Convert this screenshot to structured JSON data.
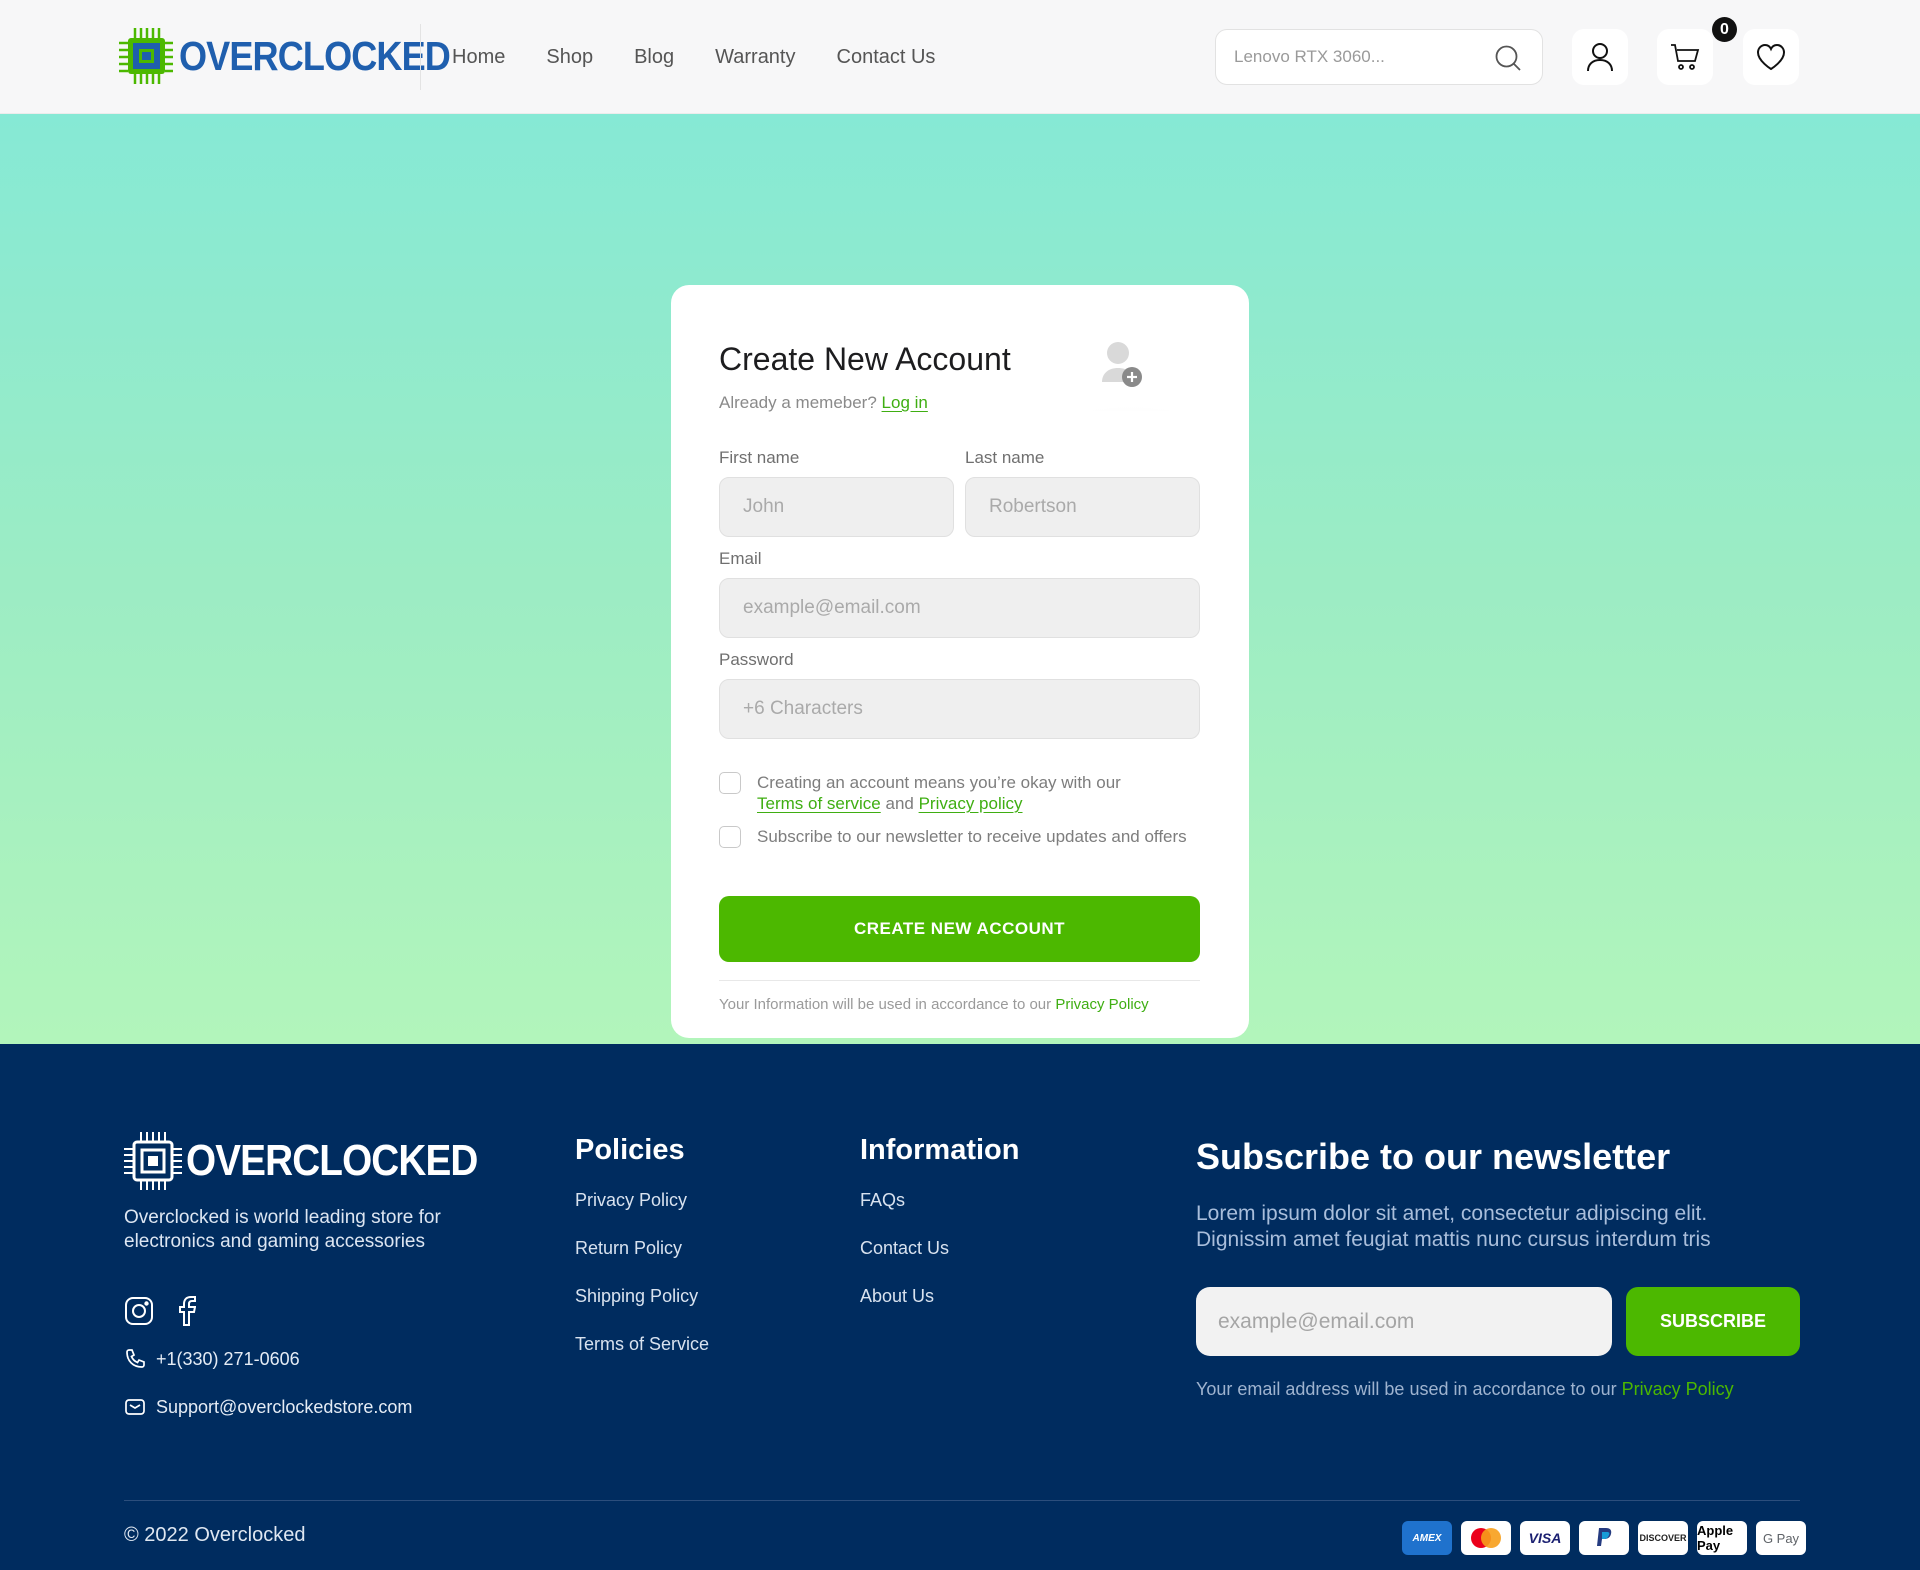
{
  "header": {
    "brand": "OVERCLOCKED",
    "nav": [
      "Home",
      "Shop",
      "Blog",
      "Warranty",
      "Contact Us"
    ],
    "search_placeholder": "Lenovo RTX 3060...",
    "cart_count": "0"
  },
  "signup": {
    "title": "Create New Account",
    "already_text": "Already a memeber?",
    "login_link": "Log in",
    "first_name_label": "First name",
    "first_name_placeholder": "John",
    "last_name_label": "Last name",
    "last_name_placeholder": "Robertson",
    "email_label": "Email",
    "email_placeholder": "example@email.com",
    "password_label": "Password",
    "password_placeholder": "+6 Characters",
    "terms_text": "Creating an account means you’re okay with our",
    "terms_link": "Terms of service",
    "terms_and": "and",
    "privacy_link": "Privacy policy",
    "newsletter_text": "Subscribe to our newsletter to receive updates and offers",
    "submit": "CREATE NEW ACCOUNT",
    "note_text": "Your Information will be used in accordance to our",
    "note_link": "Privacy Policy"
  },
  "footer": {
    "brand": "OVERCLOCKED",
    "description": "Overclocked is world leading store for electronics and gaming accessories",
    "phone": "+1(330) 271-0606",
    "email": "Support@overclockedstore.com",
    "policies_title": "Policies",
    "policies": [
      "Privacy Policy",
      "Return Policy",
      "Shipping Policy",
      "Terms of Service"
    ],
    "information_title": "Information",
    "information": [
      "FAQs",
      "Contact Us",
      "About Us"
    ],
    "newsletter_title": "Subscribe to our newsletter",
    "newsletter_desc": "Lorem ipsum dolor sit amet, consectetur adipiscing elit. Dignissim amet feugiat mattis nunc cursus interdum tris",
    "newsletter_placeholder": "example@email.com",
    "subscribe_button": "SUBSCRIBE",
    "newsletter_note": "Your email address will be used in accordance to our",
    "newsletter_note_link": "Privacy Policy",
    "copyright": "© 2022 Overclocked",
    "payments": [
      "AMEX",
      "Mastercard",
      "VISA",
      "PayPal",
      "DISCOVER",
      "Apple Pay",
      "G Pay"
    ]
  },
  "colors": {
    "accent": "#4cb800",
    "brand_blue": "#1f5fae",
    "footer_bg": "#002c5f",
    "hero_top": "#86e9d5",
    "hero_bottom": "#b2f5bb"
  }
}
